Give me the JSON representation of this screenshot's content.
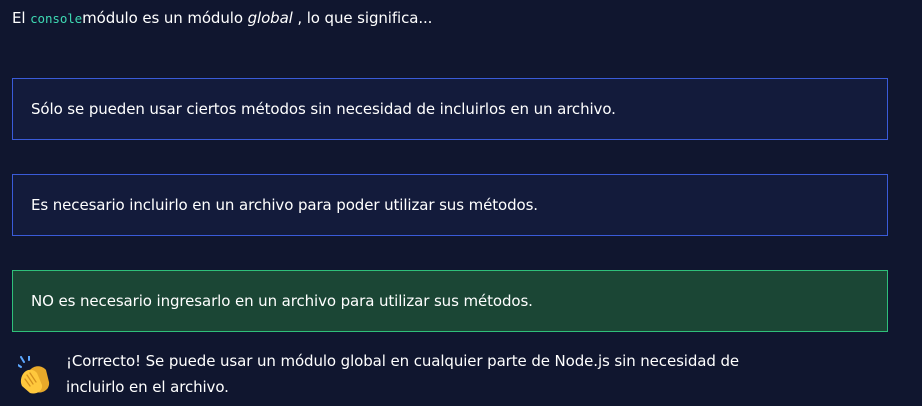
{
  "question": {
    "prefix": "El ",
    "code": "console",
    "middle": "módulo es un módulo ",
    "emphasis": "global",
    "suffix": " , lo que significa..."
  },
  "options": [
    {
      "label": "Sólo se pueden usar ciertos métodos sin necesidad de incluirlos en un archivo.",
      "state": "default"
    },
    {
      "label": "Es necesario incluirlo en un archivo para poder utilizar sus métodos.",
      "state": "default"
    },
    {
      "label": "NO es necesario ingresarlo en un archivo para utilizar sus métodos.",
      "state": "correct"
    }
  ],
  "feedback": {
    "icon": "clapping-hands-icon",
    "text": "¡Correcto! Se puede usar un módulo global en cualquier parte de Node.js sin necesidad de incluirlo en el archivo."
  },
  "colors": {
    "background": "#10162f",
    "option_background": "#131b3b",
    "option_border": "#3a5bd9",
    "correct_background": "#1b4635",
    "correct_border": "#2fbf7a",
    "code_text": "#3ed9b3"
  }
}
